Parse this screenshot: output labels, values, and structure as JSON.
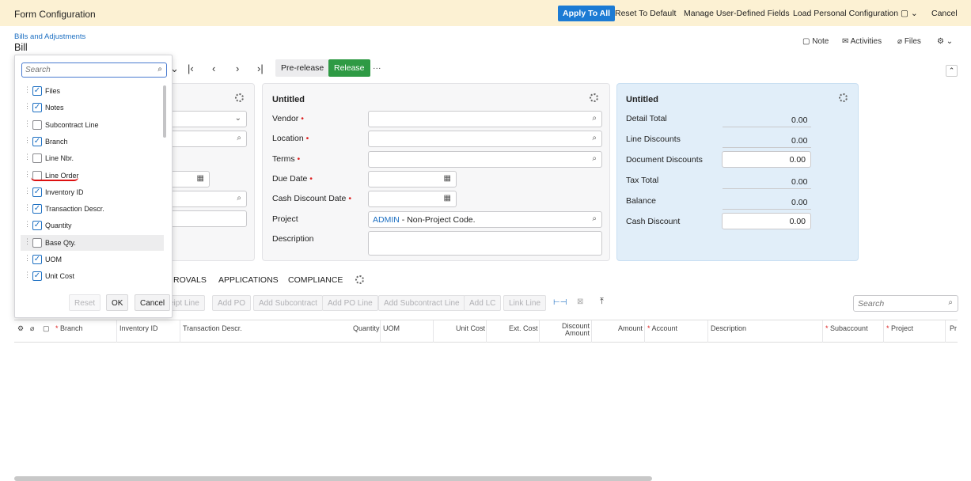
{
  "topbar": {
    "title": "Form Configuration",
    "apply_all": "Apply To All",
    "reset_default": "Reset To Default",
    "manage_udf": "Manage User-Defined Fields",
    "load_personal": "Load Personal Configuration",
    "cancel": "Cancel"
  },
  "page": {
    "breadcrumb": "Bills and Adjustments",
    "title": "Bill",
    "note": "Note",
    "activities": "Activities",
    "files": "Files"
  },
  "toolbar": {
    "prerelease": "Pre-release",
    "release": "Release",
    "more": "···"
  },
  "panel_mid": {
    "title": "Untitled",
    "vendor": "Vendor",
    "location": "Location",
    "terms": "Terms",
    "due_date": "Due Date",
    "cash_discount_date": "Cash Discount Date",
    "project": "Project",
    "project_code": "ADMIN",
    "project_rest": " - Non-Project Code.",
    "description": "Description"
  },
  "panel_right": {
    "title": "Untitled",
    "rows": [
      {
        "label": "Detail Total",
        "value": "0.00"
      },
      {
        "label": "Line Discounts",
        "value": "0.00"
      },
      {
        "label": "Document Discounts",
        "value": "0.00"
      },
      {
        "label": "Tax Total",
        "value": "0.00"
      },
      {
        "label": "Balance",
        "value": "0.00"
      },
      {
        "label": "Cash Discount",
        "value": "0.00"
      }
    ]
  },
  "tabs": [
    "ROVALS",
    "APPLICATIONS",
    "COMPLIANCE"
  ],
  "grid_buttons": [
    "ceipt Line",
    "Add PO",
    "Add Subcontract",
    "Add PO Line",
    "Add Subcontract Line",
    "Add LC",
    "Link Line"
  ],
  "grid_search_placeholder": "Search",
  "columns": [
    "Branch",
    "Inventory ID",
    "Transaction Descr.",
    "Quantity",
    "UOM",
    "Unit Cost",
    "Ext. Cost",
    "Discount",
    "Amount",
    "Amount",
    "Account",
    "Description",
    "Subaccount",
    "Project",
    "Pr"
  ],
  "popup": {
    "search_placeholder": "Search",
    "items": [
      {
        "label": "Files",
        "checked": true
      },
      {
        "label": "Notes",
        "checked": true
      },
      {
        "label": "Subcontract Line",
        "checked": false
      },
      {
        "label": "Branch",
        "checked": true
      },
      {
        "label": "Line Nbr.",
        "checked": false
      },
      {
        "label": "Line Order",
        "checked": false
      },
      {
        "label": "Inventory ID",
        "checked": true
      },
      {
        "label": "Transaction Descr.",
        "checked": true
      },
      {
        "label": "Quantity",
        "checked": true
      },
      {
        "label": "Base Qty.",
        "checked": false
      },
      {
        "label": "UOM",
        "checked": true
      },
      {
        "label": "Unit Cost",
        "checked": true
      }
    ],
    "reset": "Reset",
    "ok": "OK",
    "cancel": "Cancel"
  },
  "colors": {
    "primary": "#1c7bd4",
    "release": "#2e9a44",
    "annotation": "#d11111"
  }
}
